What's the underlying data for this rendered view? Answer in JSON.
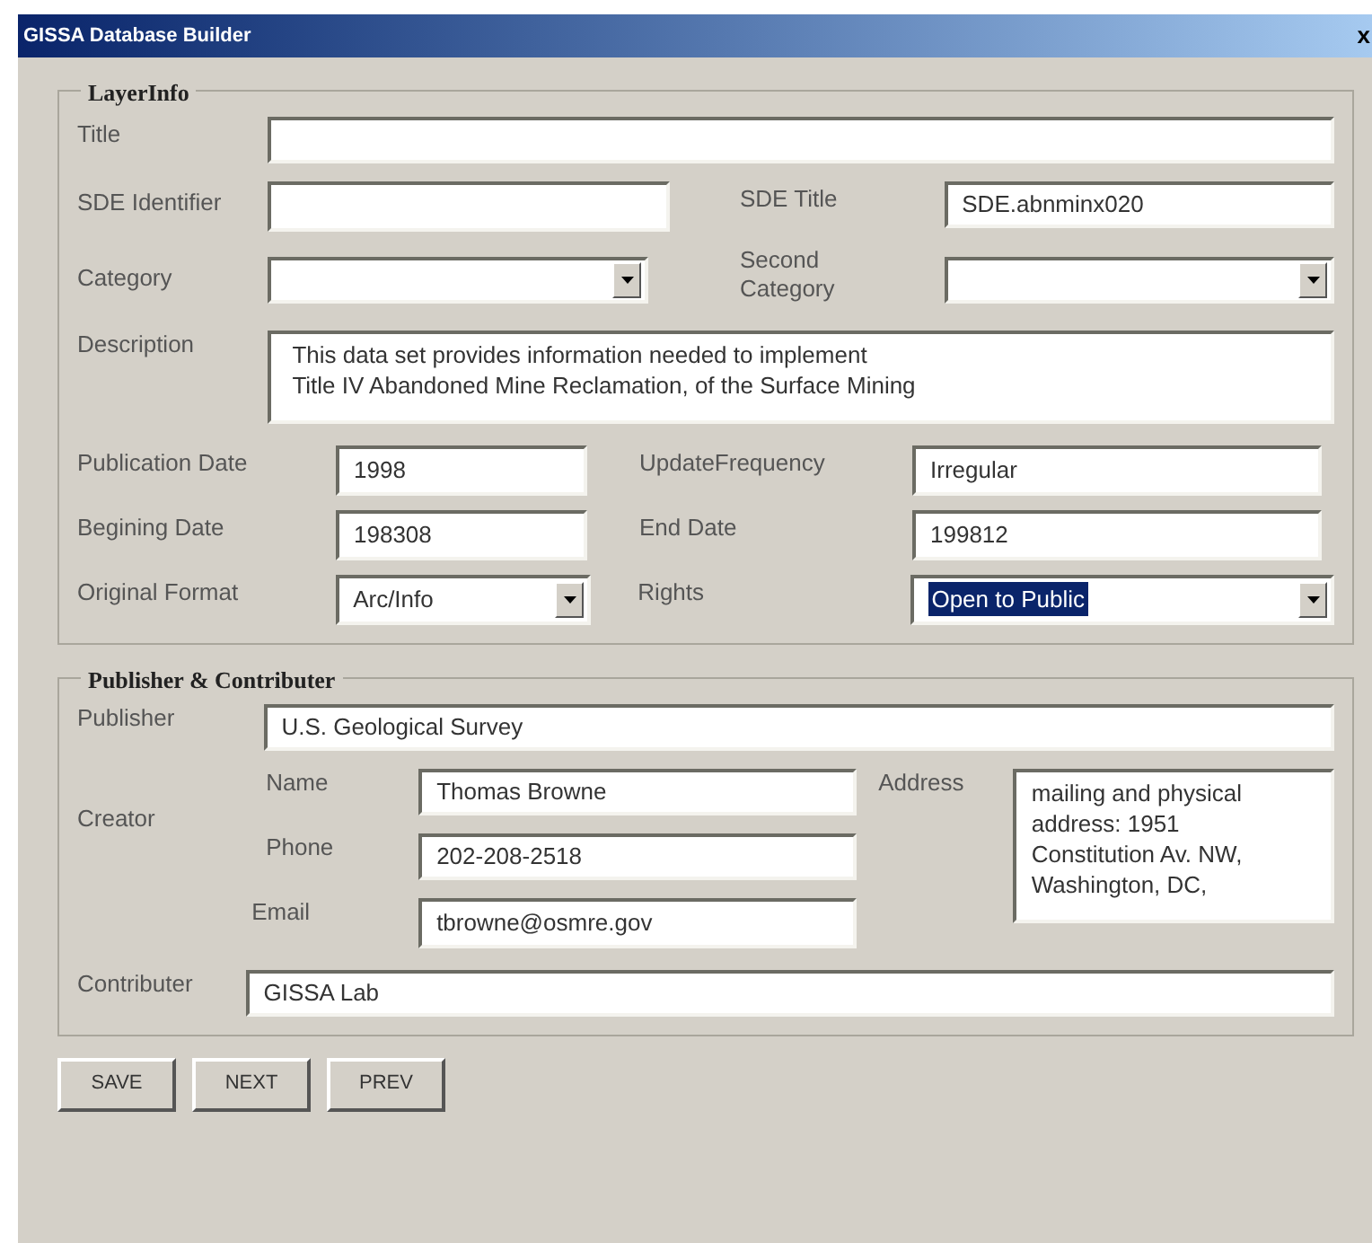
{
  "window": {
    "title": "GISSA Database Builder",
    "close": "x"
  },
  "layer_info": {
    "heading": "LayerInfo",
    "title": {
      "label": "Title"
    },
    "sde_identifier": {
      "label": "SDE Identifier"
    },
    "sde_title": {
      "label": "SDE Title",
      "value": "SDE.abnminx020"
    },
    "category": {
      "label": "Category"
    },
    "second_category": {
      "label": "Second Category"
    },
    "description": {
      "label": "Description",
      "lines": [
        "This data set provides information needed to implement",
        "Title IV Abandoned Mine Reclamation, of the Surface Mining"
      ]
    },
    "publication_date": {
      "label": "Publication Date",
      "value": "1998"
    },
    "update_frequency": {
      "label": "UpdateFrequency",
      "value": "Irregular"
    },
    "beginning_date": {
      "label": "Begining Date",
      "value": "198308"
    },
    "end_date": {
      "label": "End Date",
      "value": "199812"
    },
    "original_format": {
      "label": "Original Format",
      "value": "Arc/Info"
    },
    "rights": {
      "label": "Rights",
      "value": "Open to Public",
      "selected": true
    }
  },
  "publisher_contributer": {
    "heading": "Publisher & Contributer",
    "publisher": {
      "label": "Publisher",
      "value": "U.S. Geological Survey"
    },
    "creator": {
      "label": "Creator",
      "name": {
        "label": "Name",
        "value": "Thomas Browne"
      },
      "phone": {
        "label": "Phone",
        "value": "202-208-2518"
      },
      "email": {
        "label": "Email",
        "value": "tbrowne@osmre.gov"
      },
      "address": {
        "label": "Address",
        "lines": [
          "mailing and physical",
          "address: 1951",
          "Constitution Av. NW,",
          "Washington, DC,"
        ]
      }
    },
    "contributer": {
      "label": "Contributer",
      "value": "GISSA Lab"
    }
  },
  "buttons": [
    "SAVE",
    "NEXT",
    "PREV"
  ]
}
